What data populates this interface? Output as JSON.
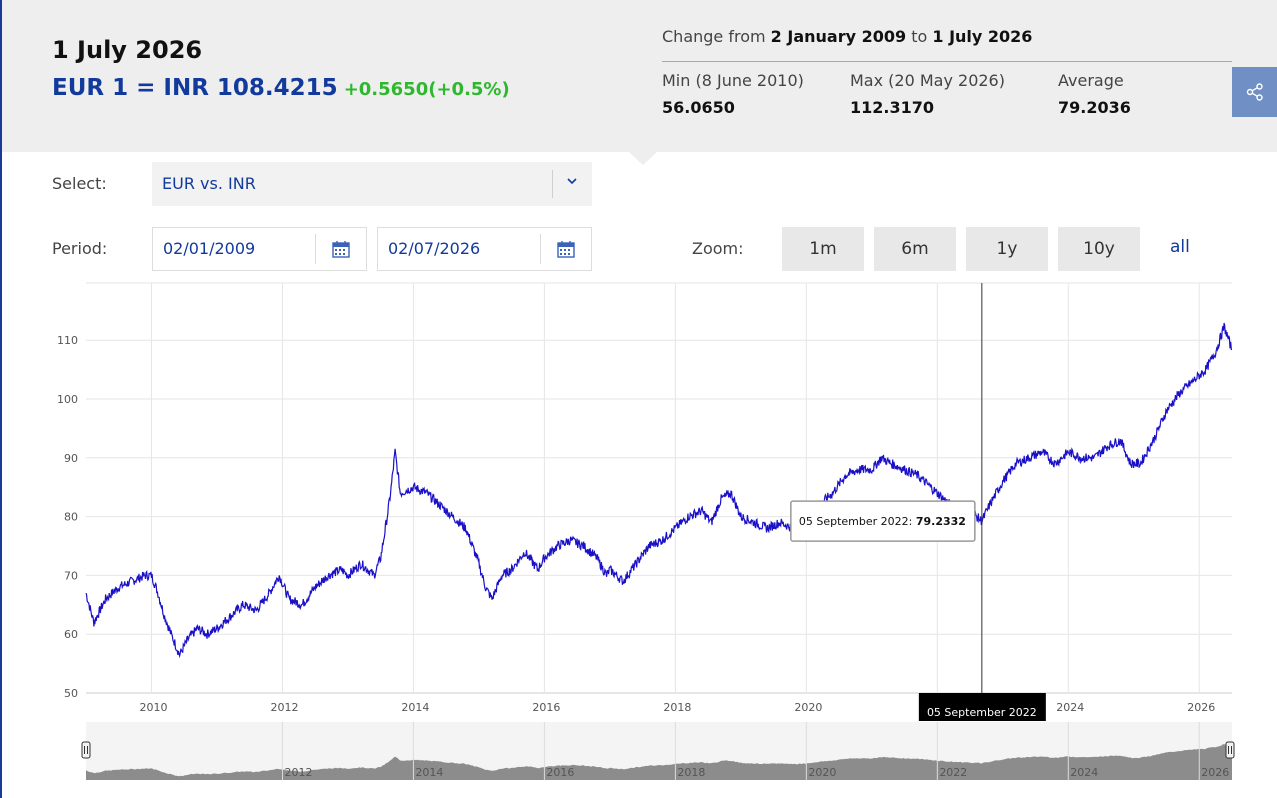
{
  "header": {
    "date": "1 July 2026",
    "rate": "EUR 1 = INR 108.4215",
    "change": "+0.5650(+0.5%)",
    "change_prefix": "Change from",
    "change_from": "2 January 2009",
    "change_to_word": "to",
    "change_to": "1 July 2026",
    "min_label": "Min (8 June 2010)",
    "min_value": "56.0650",
    "max_label": "Max (20 May 2026)",
    "max_value": "112.3170",
    "avg_label": "Average",
    "avg_value": "79.2036"
  },
  "controls": {
    "select_label": "Select:",
    "select_value": "EUR vs. INR",
    "period_label": "Period:",
    "period_from": "02/01/2009",
    "period_to": "02/07/2026",
    "zoom_label": "Zoom:",
    "zoom_options": [
      "1m",
      "6m",
      "1y",
      "10y",
      "all"
    ]
  },
  "icons": {
    "share": "share-icon",
    "dropdown": "chevron-down-icon",
    "calendar": "calendar-icon",
    "handle": "range-handle-icon"
  },
  "colors": {
    "line": "#1a10c8",
    "accent": "#123a9c",
    "positive": "#2db82d",
    "share_bg": "#6f8fc5",
    "navigator_fill": "#8c8c8c"
  },
  "tooltip": {
    "date": "05 September 2022:",
    "value": "79.2332",
    "crosshair_label": "05 September 2022"
  },
  "chart_data": {
    "type": "line",
    "series": [
      {
        "points": [
          [
            2009.0,
            67
          ],
          [
            2009.12,
            62
          ],
          [
            2009.3,
            66
          ],
          [
            2009.5,
            68
          ],
          [
            2009.7,
            69
          ],
          [
            2009.9,
            70
          ],
          [
            2010.0,
            70
          ],
          [
            2010.1,
            67
          ],
          [
            2010.2,
            63
          ],
          [
            2010.3,
            60
          ],
          [
            2010.43,
            56.5
          ],
          [
            2010.55,
            59
          ],
          [
            2010.7,
            61
          ],
          [
            2010.85,
            60
          ],
          [
            2011.0,
            61
          ],
          [
            2011.2,
            63
          ],
          [
            2011.4,
            65
          ],
          [
            2011.6,
            64
          ],
          [
            2011.8,
            67
          ],
          [
            2011.95,
            70
          ],
          [
            2012.1,
            66
          ],
          [
            2012.3,
            65
          ],
          [
            2012.5,
            68
          ],
          [
            2012.7,
            70
          ],
          [
            2012.9,
            71
          ],
          [
            2013.0,
            70
          ],
          [
            2013.2,
            72
          ],
          [
            2013.4,
            70
          ],
          [
            2013.5,
            73
          ],
          [
            2013.6,
            80
          ],
          [
            2013.65,
            84
          ],
          [
            2013.72,
            91
          ],
          [
            2013.8,
            84
          ],
          [
            2014.0,
            85
          ],
          [
            2014.2,
            84
          ],
          [
            2014.4,
            82
          ],
          [
            2014.6,
            80
          ],
          [
            2014.8,
            78
          ],
          [
            2015.0,
            72
          ],
          [
            2015.1,
            68
          ],
          [
            2015.2,
            66
          ],
          [
            2015.35,
            70
          ],
          [
            2015.5,
            71
          ],
          [
            2015.7,
            74
          ],
          [
            2015.9,
            71
          ],
          [
            2016.0,
            73
          ],
          [
            2016.2,
            75
          ],
          [
            2016.4,
            76
          ],
          [
            2016.6,
            75
          ],
          [
            2016.8,
            73
          ],
          [
            2016.95,
            70
          ],
          [
            2017.0,
            71
          ],
          [
            2017.2,
            69
          ],
          [
            2017.4,
            72
          ],
          [
            2017.6,
            75
          ],
          [
            2017.8,
            76
          ],
          [
            2018.0,
            78
          ],
          [
            2018.2,
            80
          ],
          [
            2018.4,
            81
          ],
          [
            2018.55,
            79
          ],
          [
            2018.7,
            83
          ],
          [
            2018.85,
            84
          ],
          [
            2019.0,
            80
          ],
          [
            2019.2,
            79
          ],
          [
            2019.4,
            78
          ],
          [
            2019.6,
            79
          ],
          [
            2019.8,
            78
          ],
          [
            2020.0,
            79
          ],
          [
            2020.2,
            82
          ],
          [
            2020.4,
            84
          ],
          [
            2020.6,
            87
          ],
          [
            2020.8,
            88
          ],
          [
            2021.0,
            88
          ],
          [
            2021.15,
            90
          ],
          [
            2021.3,
            89
          ],
          [
            2021.5,
            88
          ],
          [
            2021.7,
            87
          ],
          [
            2021.9,
            85
          ],
          [
            2022.0,
            84
          ],
          [
            2022.2,
            82
          ],
          [
            2022.4,
            81
          ],
          [
            2022.6,
            80
          ],
          [
            2022.68,
            79.23
          ],
          [
            2022.8,
            82
          ],
          [
            2023.0,
            86
          ],
          [
            2023.2,
            89
          ],
          [
            2023.4,
            90
          ],
          [
            2023.6,
            91
          ],
          [
            2023.8,
            89
          ],
          [
            2024.0,
            91
          ],
          [
            2024.2,
            90
          ],
          [
            2024.4,
            90
          ],
          [
            2024.6,
            92
          ],
          [
            2024.8,
            93
          ],
          [
            2024.95,
            89
          ],
          [
            2025.1,
            89
          ],
          [
            2025.3,
            93
          ],
          [
            2025.5,
            98
          ],
          [
            2025.7,
            101
          ],
          [
            2025.9,
            103
          ],
          [
            2026.1,
            105
          ],
          [
            2026.25,
            108
          ],
          [
            2026.38,
            112.3
          ],
          [
            2026.45,
            110
          ],
          [
            2026.5,
            108.4
          ]
        ]
      }
    ],
    "xlabel": "",
    "ylabel": "",
    "xlim": [
      2009.0,
      2026.5
    ],
    "ylim": [
      50,
      120
    ],
    "x_ticks": [
      "2010",
      "2012",
      "2014",
      "2016",
      "2018",
      "2020",
      "2022",
      "2024",
      "2026"
    ],
    "y_ticks": [
      50,
      60,
      70,
      80,
      90,
      100,
      110
    ],
    "grid": true,
    "navigator_labels": [
      "2012",
      "2014",
      "2016",
      "2018",
      "2020",
      "2022",
      "2024",
      "2026"
    ]
  }
}
